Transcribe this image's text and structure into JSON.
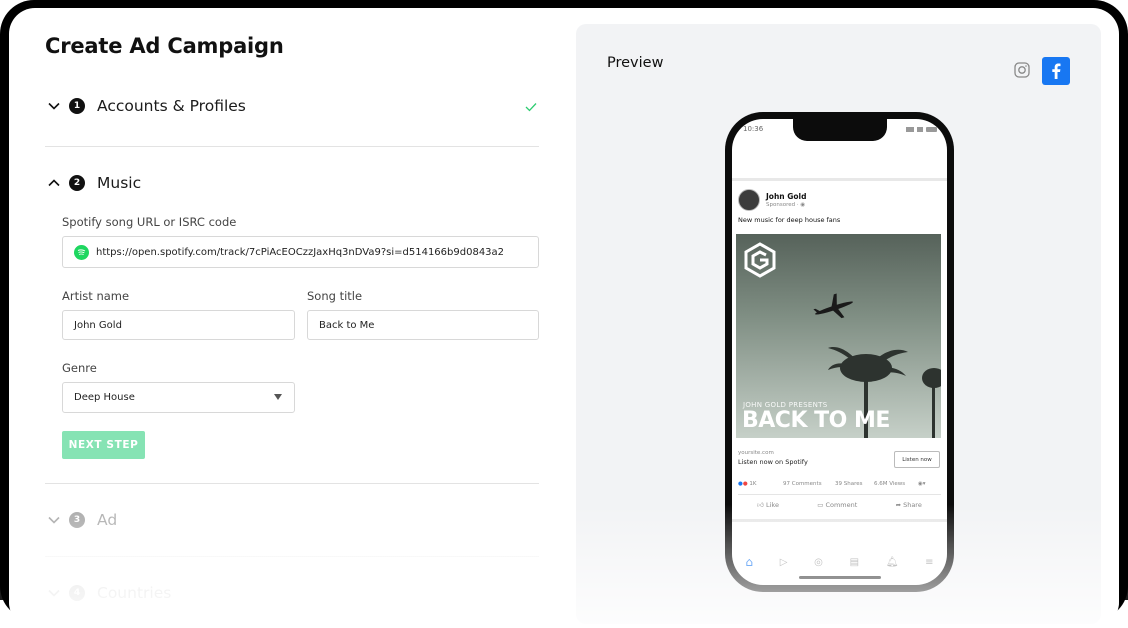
{
  "page": {
    "title": "Create Ad Campaign"
  },
  "steps": [
    {
      "number": "1",
      "label": "Accounts & Profiles",
      "state": "complete"
    },
    {
      "number": "2",
      "label": "Music",
      "state": "open"
    },
    {
      "number": "3",
      "label": "Ad",
      "state": "collapsed"
    },
    {
      "number": "4",
      "label": "Countries",
      "state": "collapsed"
    }
  ],
  "music": {
    "spotify_label": "Spotify song URL or ISRC code",
    "spotify_value": "https://open.spotify.com/track/7cPiAcEOCzzJaxHq3nDVa9?si=d514166b9d0843a2",
    "artist_label": "Artist name",
    "artist_value": "John Gold",
    "song_label": "Song title",
    "song_value": "Back to Me",
    "genre_label": "Genre",
    "genre_value": "Deep House",
    "next_label": "NEXT STEP"
  },
  "preview": {
    "title": "Preview",
    "platforms": [
      {
        "name": "instagram",
        "icon": "instagram-icon",
        "selected": false
      },
      {
        "name": "facebook",
        "icon": "facebook-icon",
        "selected": true,
        "color": "#1877f2"
      }
    ]
  },
  "phone": {
    "time": "10:36",
    "post": {
      "author": "John Gold",
      "sponsored": "Sponsored · ",
      "caption": "New music for deep house fans",
      "image_overline": "JOHN GOLD PRESENTS",
      "image_title": "BACK TO ME",
      "domain": "yoursite.com",
      "link_text": "Listen now on Spotify",
      "cta": "Listen now",
      "reactions": "1K",
      "comments": "97 Comments",
      "shares": "39 Shares",
      "views": "6.6M Views",
      "like": "Like",
      "comment": "Comment",
      "share": "Share"
    }
  },
  "colors": {
    "accent_green": "#2ecc71",
    "button_green": "#86e3b4",
    "spotify_green": "#1ed760",
    "facebook_blue": "#1877f2"
  }
}
